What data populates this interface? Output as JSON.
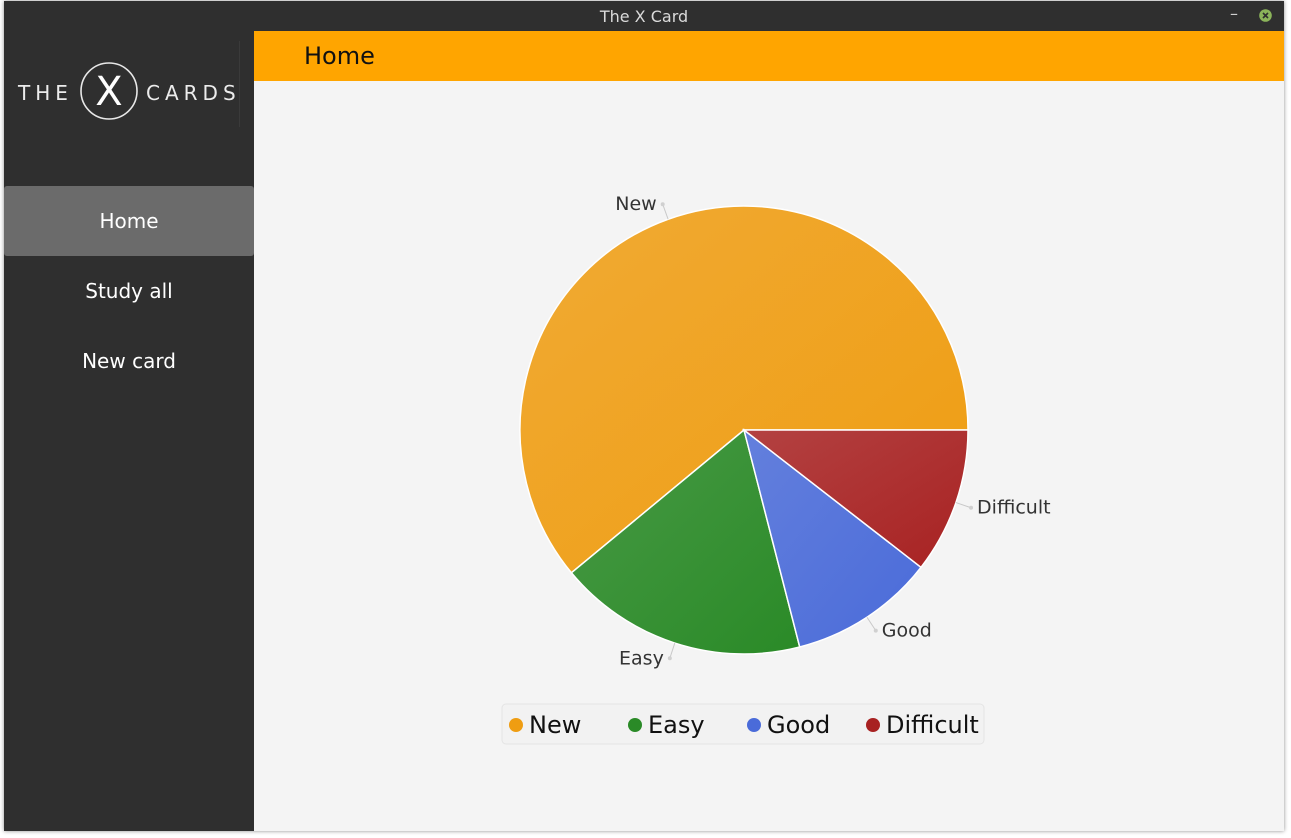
{
  "window": {
    "title": "The X Card"
  },
  "logo": {
    "left_text": "THE",
    "mark": "X",
    "right_text": "CARDS"
  },
  "sidebar": {
    "items": [
      {
        "label": "Home",
        "active": true
      },
      {
        "label": "Study all",
        "active": false
      },
      {
        "label": "New card",
        "active": false
      }
    ]
  },
  "header": {
    "title": "Home"
  },
  "colors": {
    "accent": "#ffa500",
    "sidebar_bg": "#2f2f2f",
    "active_item": "#6b6b6b",
    "content_bg": "#f4f4f4"
  },
  "chart_data": {
    "type": "pie",
    "categories": [
      "New",
      "Easy",
      "Good",
      "Difficult"
    ],
    "values": [
      61,
      18,
      10.5,
      10.5
    ],
    "colors": [
      "#ef9d12",
      "#2a8a27",
      "#4a6bd9",
      "#a82222"
    ],
    "start_angle_deg": 0,
    "direction": "counterclockwise",
    "legend": "bottom",
    "labels_shown": true
  }
}
